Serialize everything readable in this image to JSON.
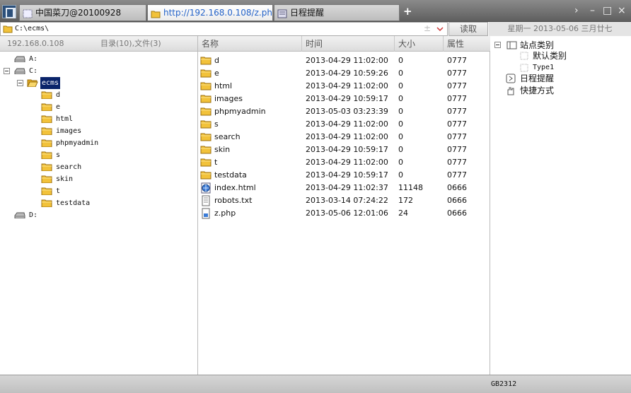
{
  "tabs": [
    {
      "label": "中国菜刀@20100928",
      "active": false
    },
    {
      "label": "http://192.168.0.108/z.php",
      "active": true
    },
    {
      "label": "日程提醒",
      "active": false
    }
  ],
  "new_tab_label": "+",
  "window_controls": {
    "next": "›",
    "minimize": "–",
    "maximize": "□",
    "close": "×"
  },
  "address": {
    "value": "C:\\ecms\\",
    "dropdown_glyph": "±"
  },
  "read_button": "读取",
  "date_display": "星期一 2013-05-06 三月廿七",
  "left_panel": {
    "host": "192.168.0.108",
    "summary": "目录(10),文件(3)",
    "tree": [
      {
        "label": "A:",
        "type": "drive"
      },
      {
        "label": "C:",
        "type": "drive",
        "expanded": true
      },
      {
        "label": "ecms",
        "type": "folder",
        "expanded": true,
        "selected": true
      },
      {
        "label": "d",
        "type": "folder"
      },
      {
        "label": "e",
        "type": "folder"
      },
      {
        "label": "html",
        "type": "folder"
      },
      {
        "label": "images",
        "type": "folder"
      },
      {
        "label": "phpmyadmin",
        "type": "folder"
      },
      {
        "label": "s",
        "type": "folder"
      },
      {
        "label": "search",
        "type": "folder"
      },
      {
        "label": "skin",
        "type": "folder"
      },
      {
        "label": "t",
        "type": "folder"
      },
      {
        "label": "testdata",
        "type": "folder"
      },
      {
        "label": "D:",
        "type": "drive"
      }
    ]
  },
  "file_list": {
    "columns": [
      "名称",
      "时间",
      "大小",
      "属性"
    ],
    "rows": [
      {
        "name": "d",
        "time": "2013-04-29 11:02:00",
        "size": "0",
        "attr": "0777",
        "icon": "folder-icon"
      },
      {
        "name": "e",
        "time": "2013-04-29 10:59:26",
        "size": "0",
        "attr": "0777",
        "icon": "folder-icon"
      },
      {
        "name": "html",
        "time": "2013-04-29 11:02:00",
        "size": "0",
        "attr": "0777",
        "icon": "folder-icon"
      },
      {
        "name": "images",
        "time": "2013-04-29 10:59:17",
        "size": "0",
        "attr": "0777",
        "icon": "folder-icon"
      },
      {
        "name": "phpmyadmin",
        "time": "2013-05-03 03:23:39",
        "size": "0",
        "attr": "0777",
        "icon": "folder-icon"
      },
      {
        "name": "s",
        "time": "2013-04-29 11:02:00",
        "size": "0",
        "attr": "0777",
        "icon": "folder-icon"
      },
      {
        "name": "search",
        "time": "2013-04-29 11:02:00",
        "size": "0",
        "attr": "0777",
        "icon": "folder-icon"
      },
      {
        "name": "skin",
        "time": "2013-04-29 10:59:17",
        "size": "0",
        "attr": "0777",
        "icon": "folder-icon"
      },
      {
        "name": "t",
        "time": "2013-04-29 11:02:00",
        "size": "0",
        "attr": "0777",
        "icon": "folder-icon"
      },
      {
        "name": "testdata",
        "time": "2013-04-29 10:59:17",
        "size": "0",
        "attr": "0777",
        "icon": "folder-icon"
      },
      {
        "name": "index.html",
        "time": "2013-04-29 11:02:37",
        "size": "11148",
        "attr": "0666",
        "icon": "html-file-icon"
      },
      {
        "name": "robots.txt",
        "time": "2013-03-14 07:24:22",
        "size": "172",
        "attr": "0666",
        "icon": "text-file-icon"
      },
      {
        "name": "z.php",
        "time": "2013-05-06 12:01:06",
        "size": "24",
        "attr": "0666",
        "icon": "php-file-icon"
      }
    ]
  },
  "right_panel": {
    "site_category": "站点类别",
    "categories": [
      "默认类别",
      "Type1"
    ],
    "schedule": "日程提醒",
    "shortcuts": "快捷方式"
  },
  "status": {
    "encoding": "GB2312"
  },
  "colors": {
    "selection": "#0a246a",
    "active_tab_text": "#2463c9",
    "folder": "#f2c23a"
  }
}
